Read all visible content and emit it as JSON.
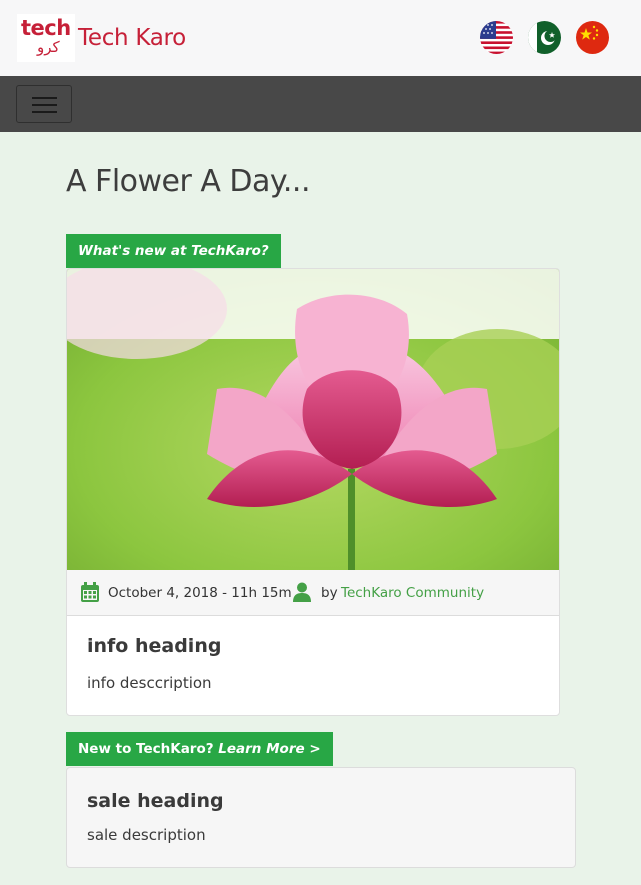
{
  "header": {
    "logo_tech": "tech",
    "logo_urdu": "کرو",
    "brand": "Tech Karo",
    "flags": [
      "us-flag-icon",
      "pakistan-flag-icon",
      "china-flag-icon"
    ]
  },
  "navbar": {
    "menu_icon": "hamburger-menu-icon"
  },
  "main": {
    "title": "A Flower A Day...",
    "post": {
      "badge": "What's new at TechKaro?",
      "image": "pink-lotus-flower-photo",
      "date": "October 4, 2018 - 11h 15m",
      "by": "by",
      "author": "TechKaro Community",
      "heading": "info heading",
      "description": "info desccription"
    },
    "promo": {
      "badge_main": "New to TechKaro?",
      "badge_link": "Learn More >",
      "heading": "sale heading",
      "description": "sale description"
    }
  },
  "colors": {
    "brand_red": "#c62038",
    "accent_green": "#28a745",
    "link_green": "#44a046",
    "navbar": "#484848",
    "page_bg": "#e9f3e9"
  }
}
